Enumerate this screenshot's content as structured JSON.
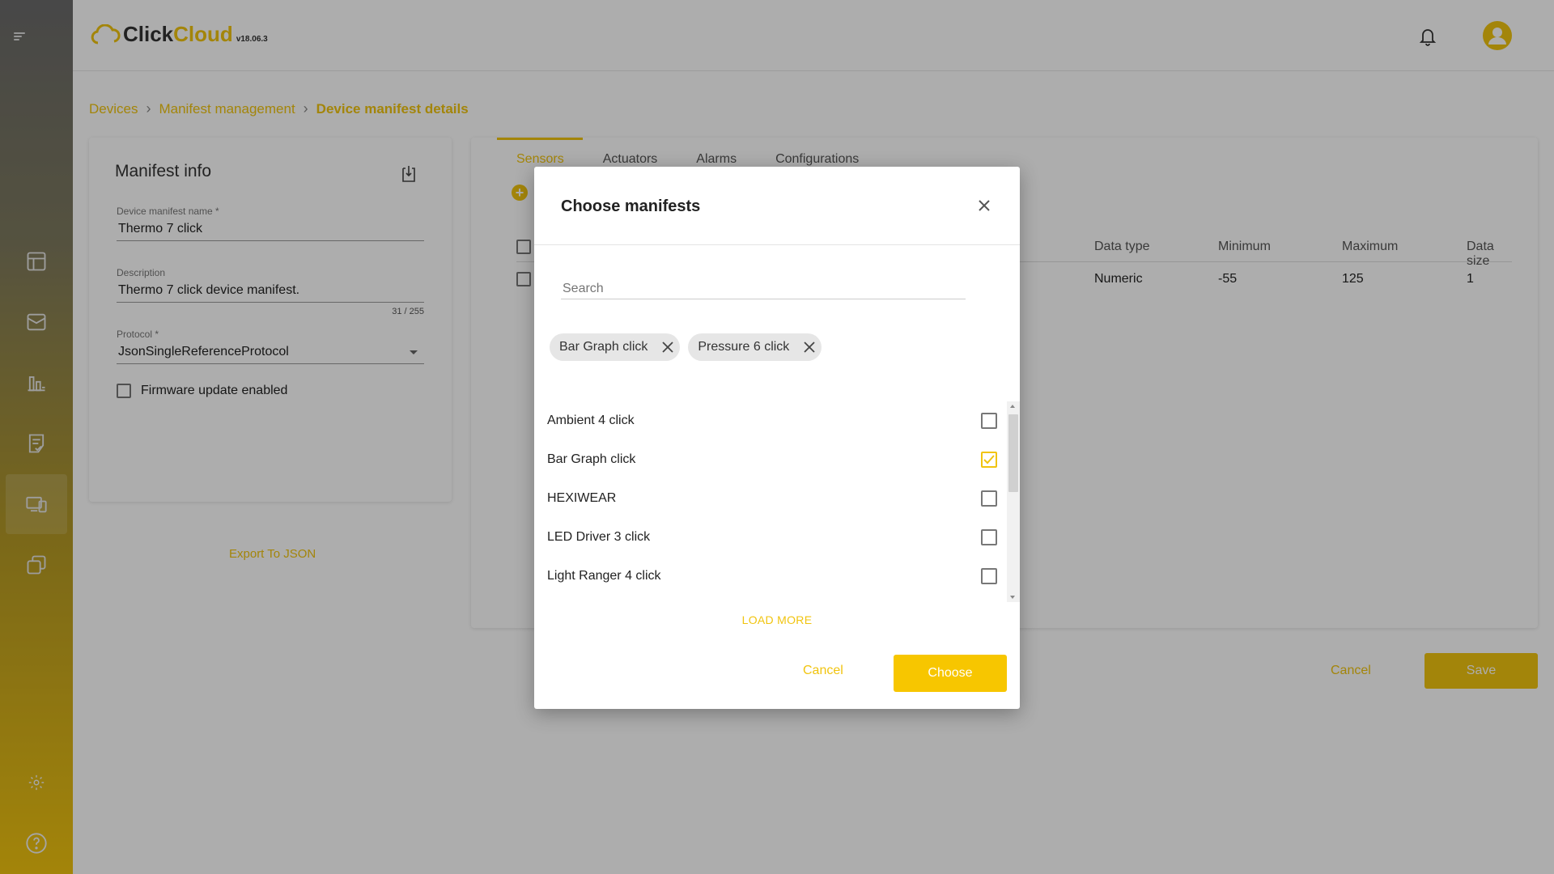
{
  "app": {
    "brand_click": "Click",
    "brand_cloud": "Cloud",
    "version": "v18.06.3"
  },
  "breadcrumb": [
    "Devices",
    "Manifest management",
    "Device manifest details"
  ],
  "manifest_info": {
    "title": "Manifest info",
    "name_label": "Device manifest name *",
    "name_value": "Thermo 7 click",
    "description_label": "Description",
    "description_value": "Thermo 7 click device manifest.",
    "description_counter": "31 / 255",
    "protocol_label": "Protocol *",
    "protocol_value": "JsonSingleReferenceProtocol",
    "firmware_label": "Firmware update enabled",
    "export_label": "Export To JSON"
  },
  "tabs": [
    "Sensors",
    "Actuators",
    "Alarms",
    "Configurations"
  ],
  "table": {
    "headers": [
      "Data type",
      "Minimum",
      "Maximum",
      "Data size"
    ],
    "rows": [
      [
        "Numeric",
        "-55",
        "125",
        "1"
      ]
    ]
  },
  "page_actions": {
    "cancel": "Cancel",
    "save": "Save"
  },
  "modal": {
    "title": "Choose manifests",
    "search_placeholder": "Search",
    "chips": [
      "Bar Graph click",
      "Pressure 6 click"
    ],
    "items": [
      {
        "label": "Ambient 4 click",
        "checked": false
      },
      {
        "label": "Bar Graph click",
        "checked": true
      },
      {
        "label": "HEXIWEAR",
        "checked": false
      },
      {
        "label": "LED Driver 3 click",
        "checked": false
      },
      {
        "label": "Light Ranger 4 click",
        "checked": false
      }
    ],
    "load_more": "LOAD MORE",
    "cancel": "Cancel",
    "choose": "Choose"
  },
  "colors": {
    "accent": "#f1c40f"
  }
}
